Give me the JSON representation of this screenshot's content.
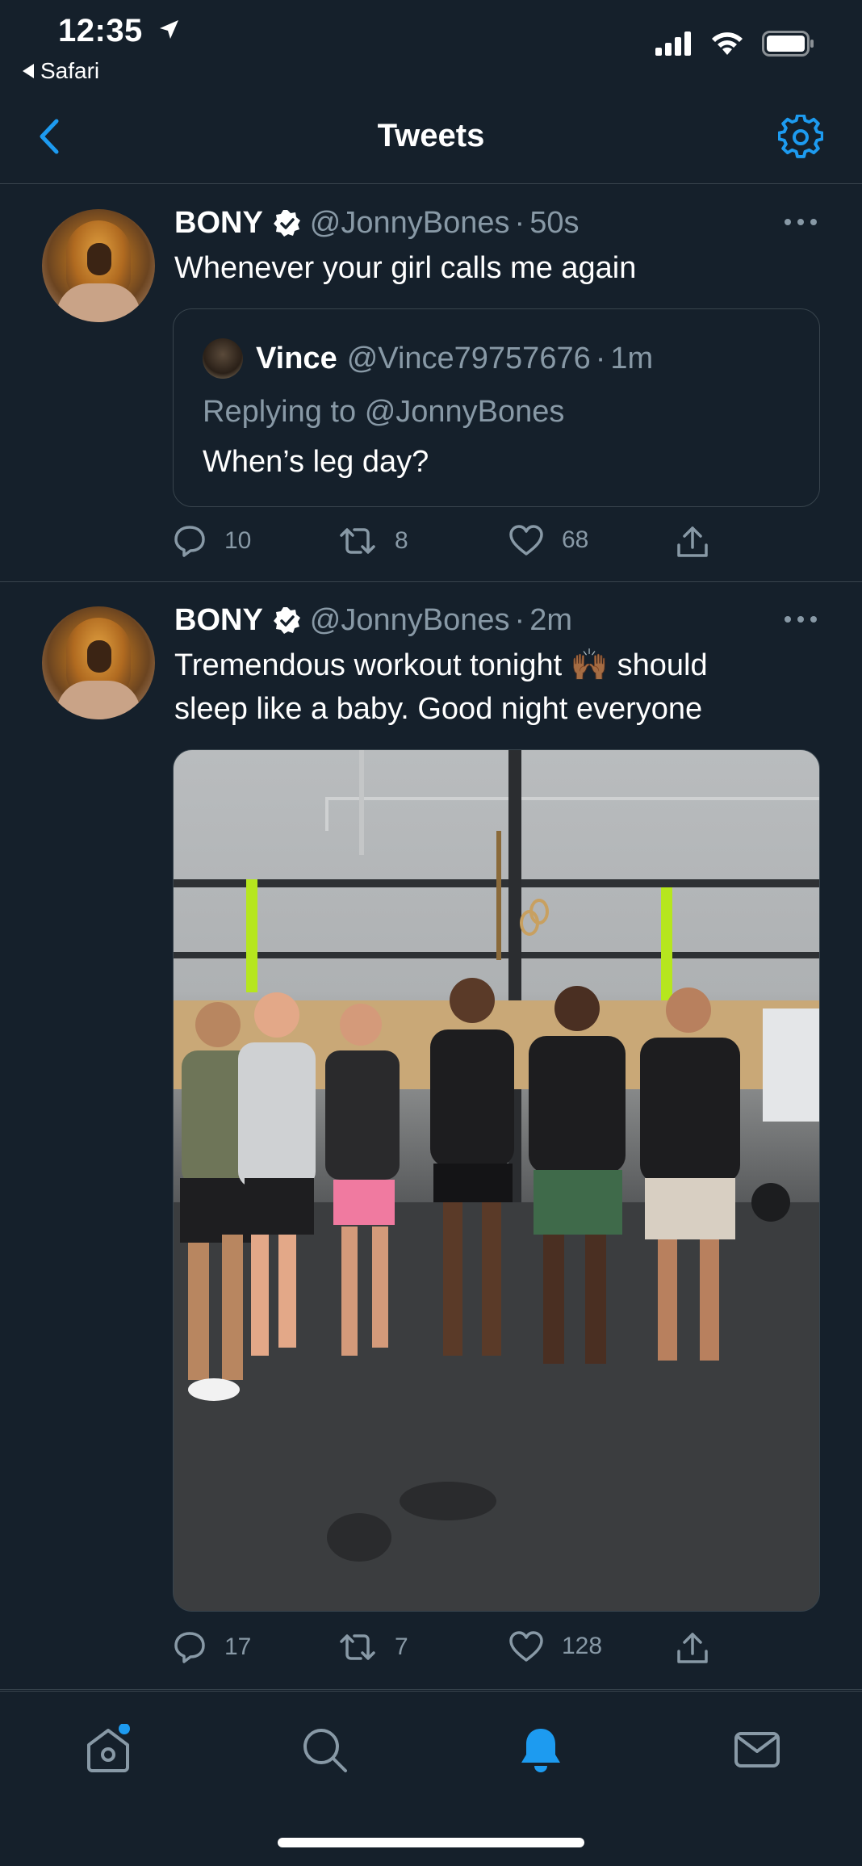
{
  "status_bar": {
    "time": "12:35",
    "back_app": "Safari"
  },
  "nav": {
    "title": "Tweets"
  },
  "tweets": [
    {
      "name": "BONY",
      "handle": "@JonnyBones",
      "dot": "·",
      "ago": "50s",
      "text": "Whenever your girl calls me again",
      "quote": {
        "name": "Vince",
        "handle": "@Vince79757676",
        "dot": "·",
        "ago": "1m",
        "replying_prefix": "Replying to",
        "replying_handle": "@JonnyBones",
        "text": "When’s leg day?"
      },
      "actions": {
        "replies": "10",
        "retweets": "8",
        "likes": "68"
      }
    },
    {
      "name": "BONY",
      "handle": "@JonnyBones",
      "dot": "·",
      "ago": "2m",
      "text_line1": "Tremendous workout tonight 🙌🏾 should",
      "text_line2": "sleep like a baby. Good night everyone",
      "actions": {
        "replies": "17",
        "retweets": "7",
        "likes": "128"
      }
    }
  ],
  "tab_bar": {
    "items": [
      {
        "icon": "home-icon",
        "active": false,
        "badge": true
      },
      {
        "icon": "search-icon",
        "active": false
      },
      {
        "icon": "notifications-bell-icon",
        "active": true
      },
      {
        "icon": "messages-icon",
        "active": false
      }
    ]
  },
  "colors": {
    "background": "#15202b",
    "accent": "#1d9bf0",
    "muted": "#8899a6",
    "divider": "#38444d"
  }
}
